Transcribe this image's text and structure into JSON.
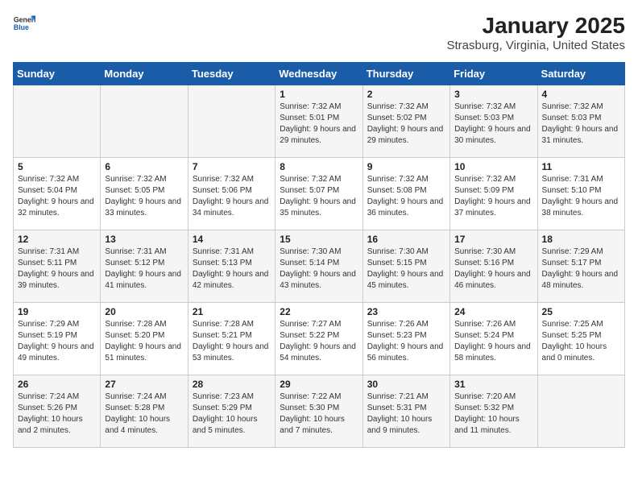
{
  "header": {
    "logo_general": "General",
    "logo_blue": "Blue",
    "title": "January 2025",
    "subtitle": "Strasburg, Virginia, United States"
  },
  "weekdays": [
    "Sunday",
    "Monday",
    "Tuesday",
    "Wednesday",
    "Thursday",
    "Friday",
    "Saturday"
  ],
  "weeks": [
    [
      {
        "num": "",
        "info": ""
      },
      {
        "num": "",
        "info": ""
      },
      {
        "num": "",
        "info": ""
      },
      {
        "num": "1",
        "info": "Sunrise: 7:32 AM\nSunset: 5:01 PM\nDaylight: 9 hours and 29 minutes."
      },
      {
        "num": "2",
        "info": "Sunrise: 7:32 AM\nSunset: 5:02 PM\nDaylight: 9 hours and 29 minutes."
      },
      {
        "num": "3",
        "info": "Sunrise: 7:32 AM\nSunset: 5:03 PM\nDaylight: 9 hours and 30 minutes."
      },
      {
        "num": "4",
        "info": "Sunrise: 7:32 AM\nSunset: 5:03 PM\nDaylight: 9 hours and 31 minutes."
      }
    ],
    [
      {
        "num": "5",
        "info": "Sunrise: 7:32 AM\nSunset: 5:04 PM\nDaylight: 9 hours and 32 minutes."
      },
      {
        "num": "6",
        "info": "Sunrise: 7:32 AM\nSunset: 5:05 PM\nDaylight: 9 hours and 33 minutes."
      },
      {
        "num": "7",
        "info": "Sunrise: 7:32 AM\nSunset: 5:06 PM\nDaylight: 9 hours and 34 minutes."
      },
      {
        "num": "8",
        "info": "Sunrise: 7:32 AM\nSunset: 5:07 PM\nDaylight: 9 hours and 35 minutes."
      },
      {
        "num": "9",
        "info": "Sunrise: 7:32 AM\nSunset: 5:08 PM\nDaylight: 9 hours and 36 minutes."
      },
      {
        "num": "10",
        "info": "Sunrise: 7:32 AM\nSunset: 5:09 PM\nDaylight: 9 hours and 37 minutes."
      },
      {
        "num": "11",
        "info": "Sunrise: 7:31 AM\nSunset: 5:10 PM\nDaylight: 9 hours and 38 minutes."
      }
    ],
    [
      {
        "num": "12",
        "info": "Sunrise: 7:31 AM\nSunset: 5:11 PM\nDaylight: 9 hours and 39 minutes."
      },
      {
        "num": "13",
        "info": "Sunrise: 7:31 AM\nSunset: 5:12 PM\nDaylight: 9 hours and 41 minutes."
      },
      {
        "num": "14",
        "info": "Sunrise: 7:31 AM\nSunset: 5:13 PM\nDaylight: 9 hours and 42 minutes."
      },
      {
        "num": "15",
        "info": "Sunrise: 7:30 AM\nSunset: 5:14 PM\nDaylight: 9 hours and 43 minutes."
      },
      {
        "num": "16",
        "info": "Sunrise: 7:30 AM\nSunset: 5:15 PM\nDaylight: 9 hours and 45 minutes."
      },
      {
        "num": "17",
        "info": "Sunrise: 7:30 AM\nSunset: 5:16 PM\nDaylight: 9 hours and 46 minutes."
      },
      {
        "num": "18",
        "info": "Sunrise: 7:29 AM\nSunset: 5:17 PM\nDaylight: 9 hours and 48 minutes."
      }
    ],
    [
      {
        "num": "19",
        "info": "Sunrise: 7:29 AM\nSunset: 5:19 PM\nDaylight: 9 hours and 49 minutes."
      },
      {
        "num": "20",
        "info": "Sunrise: 7:28 AM\nSunset: 5:20 PM\nDaylight: 9 hours and 51 minutes."
      },
      {
        "num": "21",
        "info": "Sunrise: 7:28 AM\nSunset: 5:21 PM\nDaylight: 9 hours and 53 minutes."
      },
      {
        "num": "22",
        "info": "Sunrise: 7:27 AM\nSunset: 5:22 PM\nDaylight: 9 hours and 54 minutes."
      },
      {
        "num": "23",
        "info": "Sunrise: 7:26 AM\nSunset: 5:23 PM\nDaylight: 9 hours and 56 minutes."
      },
      {
        "num": "24",
        "info": "Sunrise: 7:26 AM\nSunset: 5:24 PM\nDaylight: 9 hours and 58 minutes."
      },
      {
        "num": "25",
        "info": "Sunrise: 7:25 AM\nSunset: 5:25 PM\nDaylight: 10 hours and 0 minutes."
      }
    ],
    [
      {
        "num": "26",
        "info": "Sunrise: 7:24 AM\nSunset: 5:26 PM\nDaylight: 10 hours and 2 minutes."
      },
      {
        "num": "27",
        "info": "Sunrise: 7:24 AM\nSunset: 5:28 PM\nDaylight: 10 hours and 4 minutes."
      },
      {
        "num": "28",
        "info": "Sunrise: 7:23 AM\nSunset: 5:29 PM\nDaylight: 10 hours and 5 minutes."
      },
      {
        "num": "29",
        "info": "Sunrise: 7:22 AM\nSunset: 5:30 PM\nDaylight: 10 hours and 7 minutes."
      },
      {
        "num": "30",
        "info": "Sunrise: 7:21 AM\nSunset: 5:31 PM\nDaylight: 10 hours and 9 minutes."
      },
      {
        "num": "31",
        "info": "Sunrise: 7:20 AM\nSunset: 5:32 PM\nDaylight: 10 hours and 11 minutes."
      },
      {
        "num": "",
        "info": ""
      }
    ]
  ]
}
